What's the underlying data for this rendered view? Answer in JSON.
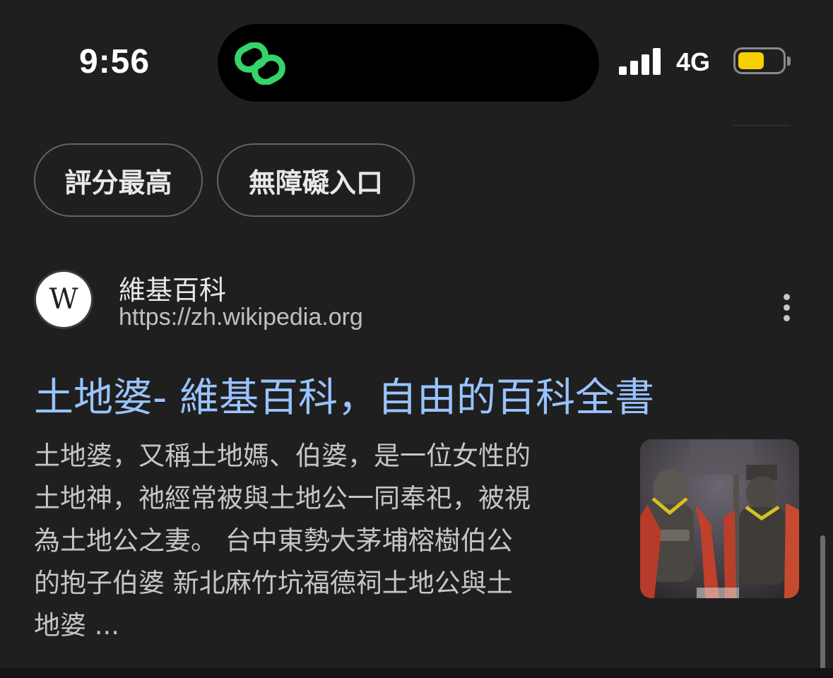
{
  "status_bar": {
    "time": "9:56",
    "network": "4G",
    "battery_level": 0.6,
    "battery_color": "#f5d000",
    "signal_bars": 4,
    "island_icon": "link-loop-icon"
  },
  "chips": [
    {
      "label": "評分最高"
    },
    {
      "label": "無障礙入口"
    }
  ],
  "result": {
    "favicon": "W",
    "site_name": "維基百科",
    "url": "https://zh.wikipedia.org",
    "more_icon": "more-vert-icon",
    "title": "土地婆- 維基百科，自由的百科全書",
    "title_color": "#99c3ff",
    "snippet_lines": [
      "土地婆，又稱土地媽、伯婆，是一位女性的",
      "土地神，祂經常被與土地公一同奉祀，被視",
      "為土地公之妻。 台中東勢大茅埔榕樹伯公",
      "的抱子伯婆 新北麻竹坑福德祠土地公與土",
      "地婆 ..."
    ],
    "thumbnail": "temple-statues-image"
  }
}
